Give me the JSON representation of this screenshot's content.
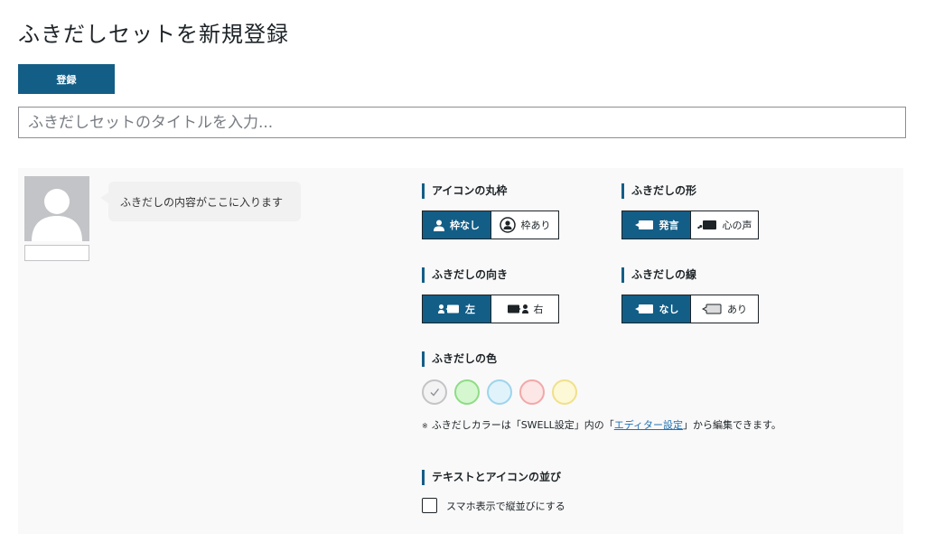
{
  "page": {
    "title": "ふきだしセットを新規登録"
  },
  "toolbar": {
    "register_label": "登録"
  },
  "title_input": {
    "placeholder": "ふきだしセットのタイトルを入力..."
  },
  "preview": {
    "bubble_text": "ふきだしの内容がここに入ります"
  },
  "settings": {
    "icon_border": {
      "label": "アイコンの丸枠",
      "options": [
        "枠なし",
        "枠あり"
      ],
      "selected": "枠なし"
    },
    "shape": {
      "label": "ふきだしの形",
      "options": [
        "発言",
        "心の声"
      ],
      "selected": "発言"
    },
    "direction": {
      "label": "ふきだしの向き",
      "options": [
        "左",
        "右"
      ],
      "selected": "左"
    },
    "line": {
      "label": "ふきだしの線",
      "options": [
        "なし",
        "あり"
      ],
      "selected": "なし"
    },
    "color": {
      "label": "ふきだしの色",
      "swatches": [
        {
          "name": "default",
          "fill": "#f3f3f3",
          "border": "#c3c4c7",
          "selected": true
        },
        {
          "name": "green",
          "fill": "#d4f7d0",
          "border": "#8fdc86",
          "selected": false
        },
        {
          "name": "blue",
          "fill": "#e0f3fb",
          "border": "#9ed4ec",
          "selected": false
        },
        {
          "name": "red",
          "fill": "#fde6e6",
          "border": "#f2a8a8",
          "selected": false
        },
        {
          "name": "yellow",
          "fill": "#fdf8d6",
          "border": "#f0e08a",
          "selected": false
        }
      ],
      "note_mark": "※",
      "note_before": "ふきだしカラーは「SWELL設定」内の「",
      "note_link": "エディター設定",
      "note_after": "」から編集できます。"
    },
    "arrangement": {
      "label": "テキストとアイコンの並び",
      "checkbox_label": "スマホ表示で縦並びにする",
      "checked": false
    }
  },
  "colors": {
    "accent": "#135e87",
    "link": "#2271b1",
    "panel_bg": "#f9f9f9"
  },
  "icons": [
    "person-icon",
    "person-circle-icon",
    "speech-bubble-icon",
    "thought-bubble-icon",
    "direction-left-icon",
    "direction-right-icon",
    "bubble-no-line-icon",
    "bubble-line-icon",
    "check-icon"
  ]
}
